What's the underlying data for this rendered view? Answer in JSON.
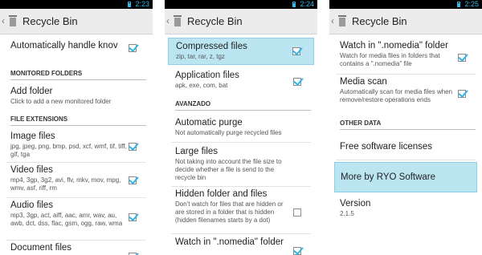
{
  "status": {
    "time1": "2:23",
    "time2": "2:24",
    "time3": "2:25"
  },
  "title": "Recycle Bin",
  "screen1": {
    "auto_handle": "Automatically handle knov",
    "header_monitored": "MONITORED FOLDERS",
    "add_folder": {
      "title": "Add folder",
      "summary": "Click to add a new monitored folder"
    },
    "header_ext": "FILE EXTENSIONS",
    "image": {
      "title": "Image files",
      "summary": "jpg, jpeg, png, bmp, psd, xcf, wmf, tif, tiff, gif, tga"
    },
    "video": {
      "title": "Video files",
      "summary": "mp4, 3gp, 3g2, avi, flv, mkv, mov, mpg, wmv, asf, riff, rm"
    },
    "audio": {
      "title": "Audio files",
      "summary": "mp3, 3gp, act, aiff, aac, amr, wav, au, awb, dct, dss, flac, gsm, ogg, raw, wma"
    },
    "document": {
      "title": "Document files"
    }
  },
  "screen2": {
    "compressed": {
      "title": "Compressed files",
      "summary": "zip, tar, rar, z, tgz"
    },
    "application": {
      "title": "Application files",
      "summary": "apk, exe, com, bat"
    },
    "header_avanzado": "AVANZADO",
    "purge": {
      "title": "Automatic purge",
      "summary": "Not automatically purge recycled files"
    },
    "large": {
      "title": "Large files",
      "summary": "Not taking into account the file size to decide whether a file is send to the recycle bin"
    },
    "hidden": {
      "title": "Hidden folder and files",
      "summary": "Don't watch for files that are hidden or are stored in a folder that is hidden (hidden filenames starts by a dot)"
    },
    "nomedia": {
      "title": "Watch in \".nomedia\" folder"
    }
  },
  "screen3": {
    "nomedia": {
      "title": "Watch in \".nomedia\" folder",
      "summary": "Watch for media files in folders that contains a \".nomedia\" file"
    },
    "mediascan": {
      "title": "Media scan",
      "summary": "Automatically scan for media files when remove/restore operations ends"
    },
    "header_other": "OTHER DATA",
    "licenses": "Free software licenses",
    "more": "More by RYO Software",
    "version": {
      "title": "Version",
      "value": "2.1.5"
    }
  },
  "colors": {
    "accent": "#33b5e5",
    "highlight": "#bce5f2",
    "actionbar": "#ececec"
  }
}
